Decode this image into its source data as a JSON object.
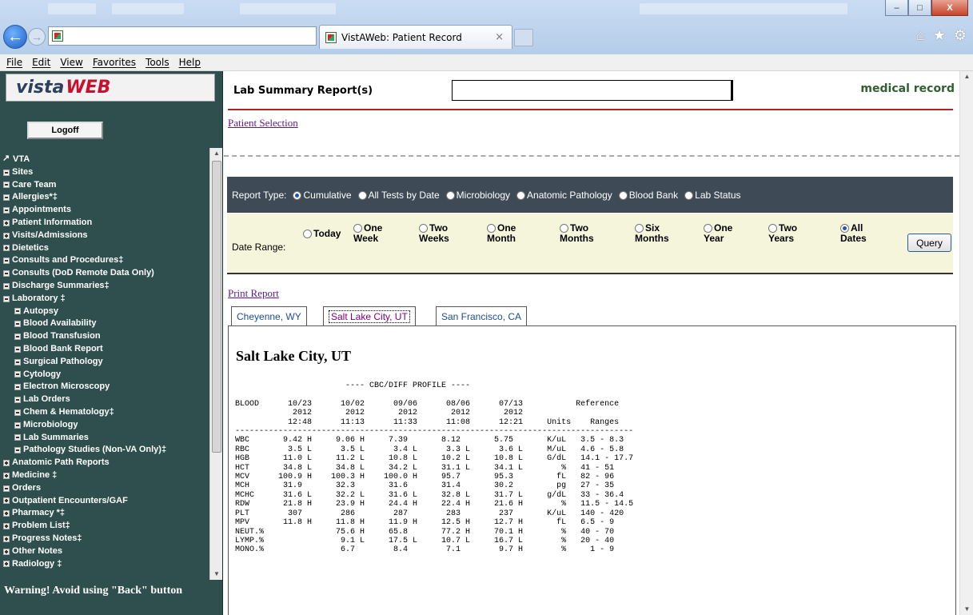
{
  "browser": {
    "tab_title": "VistAWeb: Patient Record",
    "tab_close": "×",
    "menu": [
      "File",
      "Edit",
      "View",
      "Favorites",
      "Tools",
      "Help"
    ],
    "window_buttons": {
      "minimize": "–",
      "maximize": "□",
      "close": "X"
    }
  },
  "sidebar": {
    "logo_a": "vista",
    "logo_b": "WEB",
    "logoff_label": "Logoff",
    "items": [
      {
        "label": "VTA",
        "icon": "external-link-icon",
        "level": 0
      },
      {
        "label": "Sites",
        "icon": "collapse-box-icon",
        "level": 0
      },
      {
        "label": "Care Team",
        "icon": "collapse-box-icon",
        "level": 0
      },
      {
        "label": "Allergies*‡",
        "icon": "collapse-box-icon",
        "level": 0
      },
      {
        "label": "Appointments",
        "icon": "collapse-box-icon",
        "level": 0
      },
      {
        "label": "Patient Information",
        "icon": "expand-box-icon",
        "level": 0
      },
      {
        "label": "Visits/Admissions",
        "icon": "expand-box-icon",
        "level": 0
      },
      {
        "label": "Dietetics",
        "icon": "expand-box-icon",
        "level": 0
      },
      {
        "label": "Consults and Procedures‡",
        "icon": "collapse-box-icon",
        "level": 0
      },
      {
        "label": "Consults (DoD Remote Data Only)",
        "icon": "collapse-box-icon",
        "level": 0
      },
      {
        "label": "Discharge Summaries‡",
        "icon": "collapse-box-icon",
        "level": 0
      },
      {
        "label": "Laboratory ‡",
        "icon": "collapse-box-icon",
        "level": 0
      },
      {
        "label": "Autopsy",
        "icon": "collapse-box-icon",
        "level": 1
      },
      {
        "label": "Blood Availability",
        "icon": "collapse-box-icon",
        "level": 1
      },
      {
        "label": "Blood Transfusion",
        "icon": "collapse-box-icon",
        "level": 1
      },
      {
        "label": "Blood Bank Report",
        "icon": "collapse-box-icon",
        "level": 1
      },
      {
        "label": "Surgical Pathology",
        "icon": "collapse-box-icon",
        "level": 1
      },
      {
        "label": "Cytology",
        "icon": "collapse-box-icon",
        "level": 1
      },
      {
        "label": "Electron Microscopy",
        "icon": "collapse-box-icon",
        "level": 1
      },
      {
        "label": "Lab Orders",
        "icon": "collapse-box-icon",
        "level": 1
      },
      {
        "label": "Chem & Hematology‡",
        "icon": "collapse-box-icon",
        "level": 1
      },
      {
        "label": "Microbiology",
        "icon": "collapse-box-icon",
        "level": 1
      },
      {
        "label": "Lab Summaries",
        "icon": "collapse-box-icon",
        "level": 1
      },
      {
        "label": "Pathology Studies (Non-VA Only)‡",
        "icon": "collapse-box-icon",
        "level": 1
      },
      {
        "label": "Anatomic Path Reports",
        "icon": "expand-box-icon",
        "level": 0
      },
      {
        "label": "Medicine ‡",
        "icon": "expand-box-icon",
        "level": 0
      },
      {
        "label": "Orders",
        "icon": "collapse-box-icon",
        "level": 0
      },
      {
        "label": "Outpatient Encounters/GAF",
        "icon": "expand-box-icon",
        "level": 0
      },
      {
        "label": "Pharmacy *‡",
        "icon": "expand-box-icon",
        "level": 0
      },
      {
        "label": "Problem List‡",
        "icon": "expand-box-icon",
        "level": 0
      },
      {
        "label": "Progress Notes‡",
        "icon": "expand-box-icon",
        "level": 0
      },
      {
        "label": "Other Notes",
        "icon": "expand-box-icon",
        "level": 0
      },
      {
        "label": "Radiology ‡",
        "icon": "expand-box-icon",
        "level": 0
      }
    ],
    "warning": "Warning! Avoid using \"Back\" button"
  },
  "main": {
    "report_title": "Lab Summary Report(s)",
    "patient_name_value": "",
    "medical_record": "medical record",
    "patient_selection": "Patient Selection",
    "report_type_label": "Report Type:",
    "report_types": [
      {
        "label": "Cumulative",
        "checked": true
      },
      {
        "label": "All Tests by Date",
        "checked": false
      },
      {
        "label": "Microbiology",
        "checked": false
      },
      {
        "label": "Anatomic Pathology",
        "checked": false
      },
      {
        "label": "Blood Bank",
        "checked": false
      },
      {
        "label": "Lab Status",
        "checked": false
      }
    ],
    "date_range_label": "Date Range:",
    "date_ranges": [
      {
        "l1": "Today",
        "l2": "",
        "checked": false
      },
      {
        "l1": "One",
        "l2": "Week",
        "checked": false
      },
      {
        "l1": "Two",
        "l2": "Weeks",
        "checked": false
      },
      {
        "l1": "One",
        "l2": "Month",
        "checked": false
      },
      {
        "l1": "Two",
        "l2": "Months",
        "checked": false
      },
      {
        "l1": "Six",
        "l2": "Months",
        "checked": false
      },
      {
        "l1": "One",
        "l2": "Year",
        "checked": false
      },
      {
        "l1": "Two",
        "l2": "Years",
        "checked": false
      },
      {
        "l1": "All",
        "l2": "Dates",
        "checked": true
      }
    ],
    "query_label": "Query",
    "print_report": "Print Report",
    "site_tabs": [
      {
        "label": "Cheyenne, WY",
        "selected": false
      },
      {
        "label": "Salt Lake City, UT",
        "selected": true
      },
      {
        "label": "San Francisco, CA",
        "selected": false
      }
    ],
    "site_heading": "Salt Lake City, UT",
    "report_text": "                       ---- CBC/DIFF PROFILE ----\n\nBLOOD      10/23      10/02      09/06      08/06      07/13           Reference\n            2012       2012       2012       2012       2012\n           12:48      11:13      11:33      11:08      12:21     Units    Ranges\n-----------------------------------------------------------------------------------\nWBC       9.42 H     9.06 H     7.39       8.12       5.75       K/uL   3.5 - 8.3\nRBC        3.5 L      3.5 L      3.4 L      3.3 L      3.6 L     M/uL   4.6 - 5.8\nHGB       11.0 L     11.2 L     10.8 L     10.2 L     10.8 L     G/dL   14.1 - 17.7\nHCT       34.8 L     34.8 L     34.2 L     31.1 L     34.1 L        %   41 - 51\nMCV      100.9 H    100.3 H    100.0 H     95.7       95.3         fL   82 - 96\nMCH       31.9       32.3       31.6       31.4       30.2         pg   27 - 35\nMCHC      31.6 L     32.2 L     31.6 L     32.8 L     31.7 L     g/dL   33 - 36.4\nRDW       21.8 H     23.9 H     24.4 H     22.4 H     21.6 H        %   11.5 - 14.5\nPLT        307        286        287        283        237       K/uL   140 - 420\nMPV       11.8 H     11.8 H     11.9 H     12.5 H     12.7 H       fL   6.5 - 9\nNEUT.%               75.6 H     65.8       77.2 H     70.1 H        %   40 - 70\nLYMP.%                9.1 L     17.5 L     10.7 L     16.7 L        %   20 - 40\nMONO.%                6.7        8.4        7.1        9.7 H        %     1 - 9"
  }
}
